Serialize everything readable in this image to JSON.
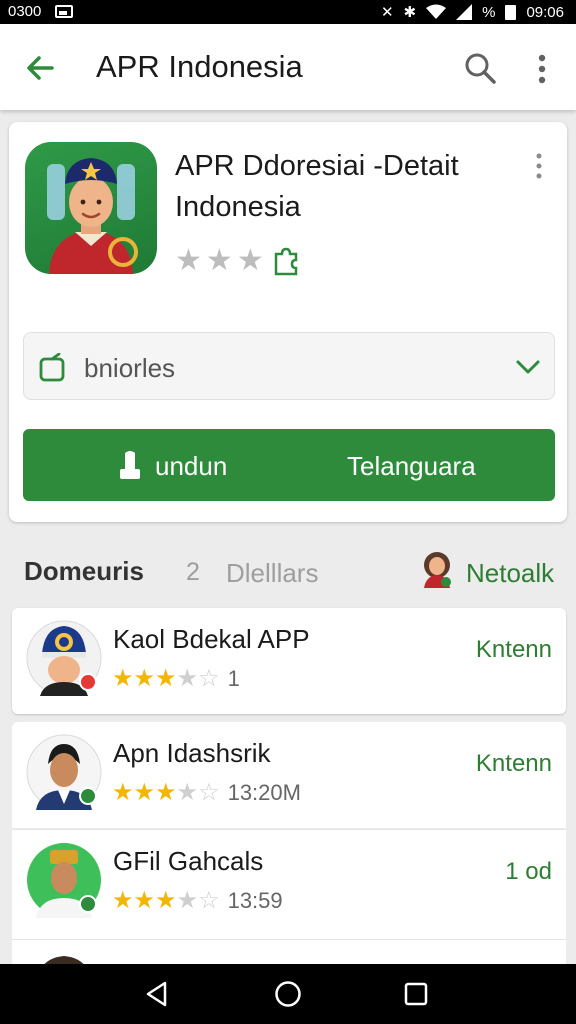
{
  "status_bar": {
    "time_left": "0300",
    "time_right": "09:06",
    "battery_text": "%"
  },
  "app_bar": {
    "title": "APR Indonesia"
  },
  "app": {
    "title": "APR Ddoresiai -Detait Indonesia",
    "rating_stars": 3,
    "dropdown_label": "bniorles",
    "install_left_label": "undun",
    "install_right_label": "Telanguara"
  },
  "section": {
    "title": "Domeuris",
    "count": "2",
    "subtitle": "Dlelllars",
    "link": "Netoalk"
  },
  "list": [
    {
      "name": "Kaol Bdekal APP",
      "stars": 3,
      "meta": "1",
      "action": "Kntenn"
    },
    {
      "name": "Apn Idashsrik",
      "stars": 3,
      "meta": "13:20M",
      "action": "Kntenn"
    },
    {
      "name": "GFil Gahcals",
      "stars": 3,
      "meta": "13:59",
      "action": "1 od"
    }
  ],
  "colors": {
    "accent": "#2e8b3c",
    "star": "#f2b705",
    "link": "#2e7d32"
  }
}
